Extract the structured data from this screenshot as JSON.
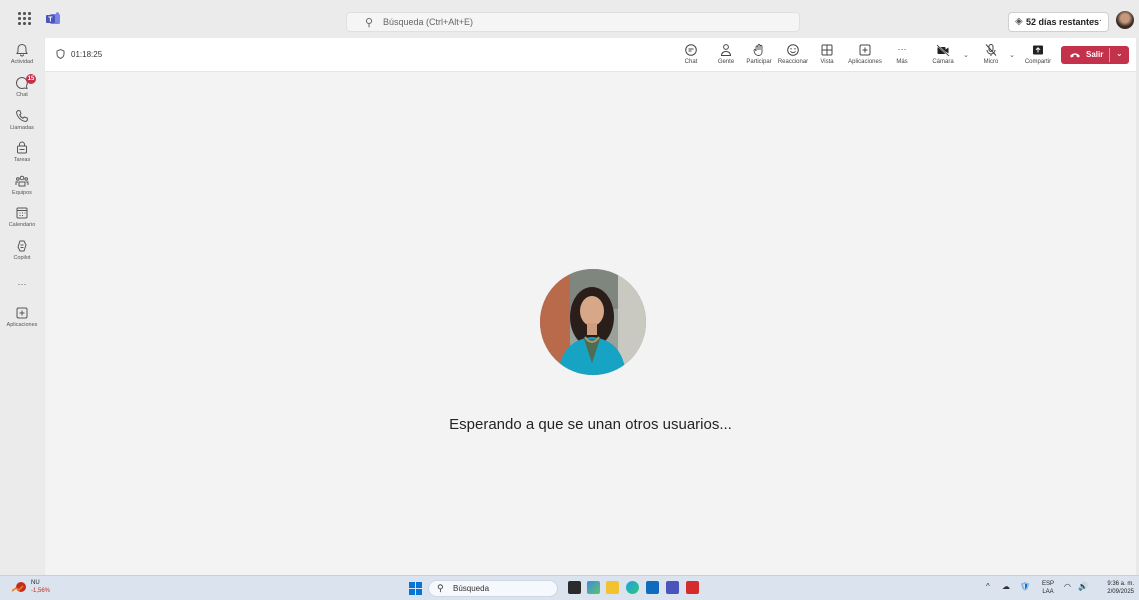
{
  "titlebar": {
    "search_placeholder": "Búsqueda (Ctrl+Alt+E)",
    "trial_label": "52 días restantes",
    "more": "···"
  },
  "rail": {
    "items": [
      {
        "label": "Actividad"
      },
      {
        "label": "Chat",
        "badge": "15"
      },
      {
        "label": "Llamadas"
      },
      {
        "label": "Tareas"
      },
      {
        "label": "Equipos"
      },
      {
        "label": "Calendario"
      },
      {
        "label": "Copilot"
      },
      {
        "label": "···"
      },
      {
        "label": "Aplicaciones"
      }
    ]
  },
  "meeting": {
    "timer": "01:18:25",
    "toolbar": {
      "chat": "Chat",
      "people": "Gente",
      "raise": "Participar",
      "react": "Reaccionar",
      "view": "Vista",
      "apps": "Aplicaciones",
      "more": "Más",
      "camera": "Cámara",
      "mic": "Micro",
      "share": "Compartir",
      "leave": "Salir"
    },
    "waiting_text": "Esperando a que se unan otros usuarios..."
  },
  "taskbar": {
    "stock_name": "NU",
    "stock_change": "-1,56%",
    "search_label": "Búsqueda",
    "lang_top": "ESP",
    "lang_bottom": "LAA",
    "time": "9:36 a. m.",
    "date": "2/09/2025"
  },
  "colors": {
    "accent": "#5b5fc7",
    "leave": "#c4314b",
    "badge": "#c4314b"
  }
}
